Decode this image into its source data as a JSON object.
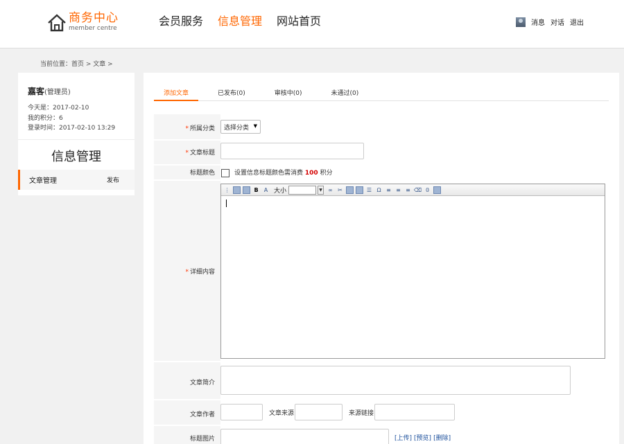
{
  "header": {
    "logo_title": "商务中心",
    "logo_subtitle": "member centre",
    "nav": [
      {
        "label": "会员服务",
        "active": false
      },
      {
        "label": "信息管理",
        "active": true
      },
      {
        "label": "网站首页",
        "active": false
      }
    ],
    "user_links": {
      "messages": "消息",
      "chat": "对话",
      "logout": "退出"
    }
  },
  "breadcrumb": "当前位置：首页 > 文章 >",
  "sidebar": {
    "user_name": "嘉客",
    "user_role": "(管理员)",
    "today": "今天是：2017-02-10",
    "points": "我的积分：6",
    "login_time": "登录时间：2017-02-10 13:29",
    "section_title": "信息管理",
    "menu_item": "文章管理",
    "menu_action": "发布"
  },
  "tabs": [
    {
      "label": "添加文章",
      "active": true
    },
    {
      "label": "已发布(0)",
      "active": false
    },
    {
      "label": "审核中(0)",
      "active": false
    },
    {
      "label": "未通过(0)",
      "active": false
    }
  ],
  "form": {
    "category_label": "所属分类",
    "category_value": "选择分类",
    "title_label": "文章标题",
    "color_label": "标题颜色",
    "color_note_prefix": "设置信息标题颜色需消费",
    "color_note_points": "100",
    "color_note_suffix": "积分",
    "content_label": "详细内容",
    "editor_size_label": "大小",
    "summary_label": "文章简介",
    "author_label": "文章作者",
    "source_label": "文章来源",
    "source_link_label": "来源链接",
    "image_label": "标题图片",
    "upload": "[上传]",
    "preview": "[预览]",
    "delete": "[删除]"
  },
  "colors": {
    "accent": "#ff6600",
    "required": "#ff3300",
    "link": "#1a4e9b"
  }
}
